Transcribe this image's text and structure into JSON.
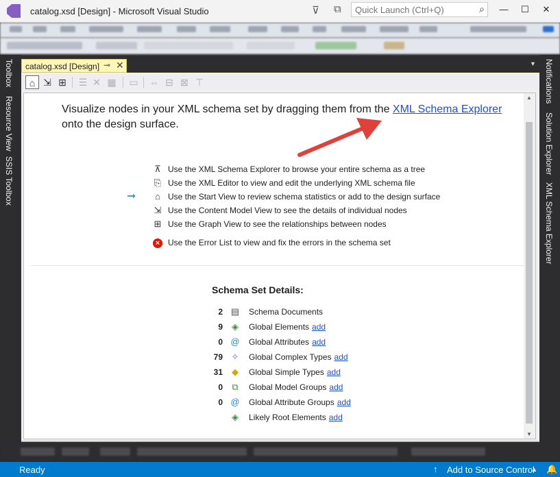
{
  "window": {
    "title": "catalog.xsd [Design] - Microsoft Visual Studio",
    "quick_launch_placeholder": "Quick Launch (Ctrl+Q)",
    "icons": [
      "vs-logo",
      "filter-icon",
      "feedback-icon",
      "search-icon",
      "minimize-icon",
      "maximize-icon",
      "close-icon"
    ],
    "controls": {
      "minimize": "—",
      "maximize": "☐",
      "close": "✕"
    }
  },
  "left_rail": [
    "Toolbox",
    "Resource View",
    "SSIS Toolbox"
  ],
  "right_rail": [
    "Notifications",
    "Solution Explorer",
    "XML Schema Explorer"
  ],
  "document_tab": {
    "label": "catalog.xsd [Design]",
    "pin": "⊸",
    "close": "✕",
    "dropdown": "▼"
  },
  "toolbar_icons": [
    "start-view-icon",
    "content-model-view-icon",
    "graph-view-icon",
    "add-icon",
    "remove-icon",
    "clear-icon",
    "expand-icon",
    "collapse-icon",
    "diagram-icon",
    "filter-icon"
  ],
  "intro": {
    "prefix": "Visualize nodes in your XML schema set by dragging them from the ",
    "link": "XML Schema Explorer",
    "suffix": "onto the design surface."
  },
  "help_items": [
    {
      "icon": "schema-explorer-icon",
      "text": "Use the XML Schema Explorer to browse your entire schema as a tree"
    },
    {
      "icon": "xml-editor-icon",
      "text": "Use the XML Editor to view and edit the underlying XML schema file"
    },
    {
      "icon": "start-view-icon",
      "text": "Use the Start View to review schema statistics or add to the design surface"
    },
    {
      "icon": "content-model-view-icon",
      "text": "Use the Content Model View to see the details of individual nodes"
    },
    {
      "icon": "graph-view-icon",
      "text": "Use the Graph View to see the relationships between nodes"
    },
    {
      "icon": "error-icon",
      "text": "Use the Error List to view and fix the errors in the schema set"
    }
  ],
  "details": {
    "title": "Schema Set Details:",
    "add_label": "add",
    "rows": [
      {
        "count": "2",
        "icon": "schema-documents-icon",
        "label": "Schema Documents",
        "has_add": false
      },
      {
        "count": "9",
        "icon": "global-elements-icon",
        "label": "Global Elements",
        "has_add": true
      },
      {
        "count": "0",
        "icon": "global-attributes-icon",
        "label": "Global Attributes",
        "has_add": true
      },
      {
        "count": "79",
        "icon": "complex-types-icon",
        "label": "Global Complex Types",
        "has_add": true
      },
      {
        "count": "31",
        "icon": "simple-types-icon",
        "label": "Global Simple Types",
        "has_add": true
      },
      {
        "count": "0",
        "icon": "model-groups-icon",
        "label": "Global Model Groups",
        "has_add": true
      },
      {
        "count": "0",
        "icon": "attribute-groups-icon",
        "label": "Global Attribute Groups",
        "has_add": true
      },
      {
        "count": "",
        "icon": "root-elements-icon",
        "label": "Likely Root Elements",
        "has_add": true
      }
    ]
  },
  "status": {
    "text": "Ready",
    "source_control": "Add to Source Control",
    "caret": "▲"
  },
  "colors": {
    "accent": "#007acc",
    "tab": "#fff7b7",
    "link": "#1f4fd8",
    "arrow": "#e0413a",
    "error": "#e51400"
  }
}
